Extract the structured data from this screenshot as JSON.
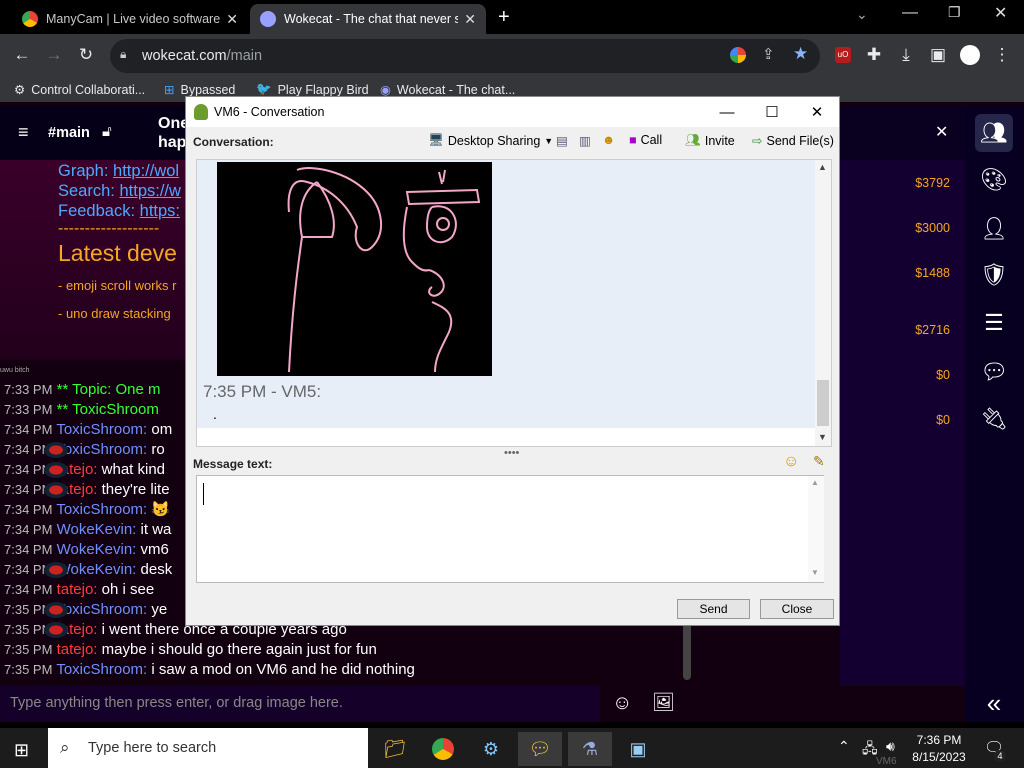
{
  "browser": {
    "tabs": [
      {
        "title": "ManyCam | Live video software &"
      },
      {
        "title": "Wokecat - The chat that never sle"
      }
    ],
    "url_host": "wokecat.com",
    "url_path": "/main",
    "bookmarks": [
      "Control Collaborati...",
      "Bypassed",
      "Play Flappy Bird",
      "Wokecat - The chat..."
    ]
  },
  "chat": {
    "channel": "#main",
    "header_text": "One",
    "header_text2": "hap",
    "links": [
      {
        "label": "Graph:",
        "link": "http://wol"
      },
      {
        "label": "Search:",
        "link": "https://w"
      },
      {
        "label": "Feedback:",
        "link": "https:"
      }
    ],
    "divider": "-------------------",
    "latest": "Latest deve",
    "dev_items": [
      "- emoji scroll works r",
      "- uno draw stacking"
    ],
    "small_user": "uwu bitch",
    "messages": [
      {
        "time": "7:33 PM",
        "user": "** Topic: One m",
        "text": "",
        "cls": "u3"
      },
      {
        "time": "7:33 PM",
        "user": "** ToxicShroom",
        "text": "",
        "cls": "u3"
      },
      {
        "time": "7:34 PM",
        "user": "ToxicShroom:",
        "text": "om",
        "cls": "u1"
      },
      {
        "time": "7:34 PM",
        "user": "ToxicShroom:",
        "text": "ro",
        "cls": "u1"
      },
      {
        "time": "7:34 PM",
        "user": "tatejo:",
        "text": "what kind",
        "cls": "u2"
      },
      {
        "time": "7:34 PM",
        "user": "tatejo:",
        "text": "they're lite",
        "cls": "u2"
      },
      {
        "time": "7:34 PM",
        "user": "ToxicShroom:",
        "text": "😼",
        "cls": "u1"
      },
      {
        "time": "7:34 PM",
        "user": "WokeKevin:",
        "text": "it wa",
        "cls": "u1"
      },
      {
        "time": "7:34 PM",
        "user": "WokeKevin:",
        "text": "vm6",
        "cls": "u1"
      },
      {
        "time": "7:34 PM",
        "user": "WokeKevin:",
        "text": "desk",
        "cls": "u1"
      },
      {
        "time": "7:34 PM",
        "user": "tatejo:",
        "text": "oh i see",
        "cls": "u2"
      },
      {
        "time": "7:35 PM",
        "user": "ToxicShroom:",
        "text": "ye",
        "cls": "u1"
      },
      {
        "time": "7:35 PM",
        "user": "tatejo:",
        "text": "i went there once a couple years ago",
        "cls": "u2"
      },
      {
        "time": "7:35 PM",
        "user": "tatejo:",
        "text": "maybe i should go there again just for fun",
        "cls": "u2"
      },
      {
        "time": "7:35 PM",
        "user": "ToxicShroom:",
        "text": "i saw a mod on VM6 and he did nothing",
        "cls": "u1"
      }
    ],
    "input_placeholder": "Type anything then press enter, or drag image here."
  },
  "balances": [
    "$3792",
    "$3000",
    "$1488",
    "$2716",
    "$0",
    "$0"
  ],
  "dialog": {
    "title": "VM6 - Conversation",
    "conversation_label": "Conversation:",
    "toolbar": {
      "desktop_sharing": "Desktop Sharing",
      "call": "Call",
      "invite": "Invite",
      "send_files": "Send File(s)"
    },
    "message_header": "7:35 PM - VM5:",
    "message_body": ".",
    "message_text_label": "Message text:",
    "send": "Send",
    "close": "Close"
  },
  "taskbar": {
    "search_placeholder": "Type here to search",
    "time": "7:36 PM",
    "date": "8/15/2023",
    "notif_count": "4",
    "tray_label": "VM6"
  },
  "colors": {
    "accent": "#f5a623",
    "link": "#6f8fff",
    "user_red": "#ff3b3b"
  }
}
